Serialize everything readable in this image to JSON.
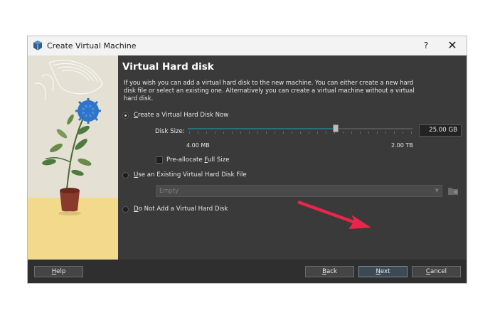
{
  "window": {
    "title": "Create Virtual Machine",
    "help_glyph": "?",
    "close_glyph": "✕"
  },
  "page": {
    "heading": "Virtual Hard disk",
    "description": "If you wish you can add a virtual hard disk to the new machine. You can either create a new hard disk file or select an existing one. Alternatively you can create a virtual machine without a virtual hard disk."
  },
  "options": {
    "create_new": {
      "label_prefix": "C",
      "label_rest": "reate a Virtual Hard Disk Now",
      "selected": true
    },
    "disk_size_label": "Disk Size:",
    "disk_size_value": "25.00 GB",
    "slider_fraction": 0.67,
    "slider_min": "4.00 MB",
    "slider_max": "2.00 TB",
    "preallocate": {
      "label_a": "Pre-allocate ",
      "label_u": "F",
      "label_b": "ull Size",
      "checked": false
    },
    "use_existing": {
      "label_prefix": "U",
      "label_rest": "se an Existing Virtual Hard Disk File",
      "selected": false
    },
    "existing_combo_value": "Empty",
    "no_disk": {
      "label_prefix": "D",
      "label_rest": "o Not Add a Virtual Hard Disk",
      "selected": false
    }
  },
  "footer": {
    "help": {
      "u": "H",
      "rest": "elp"
    },
    "back": {
      "u": "B",
      "rest": "ack"
    },
    "next": {
      "u": "N",
      "rest": "ext"
    },
    "cancel": {
      "u": "C",
      "rest": "ancel"
    }
  },
  "colors": {
    "accent_arrow": "#e8264a",
    "slider_fill": "#2a6e7a"
  }
}
